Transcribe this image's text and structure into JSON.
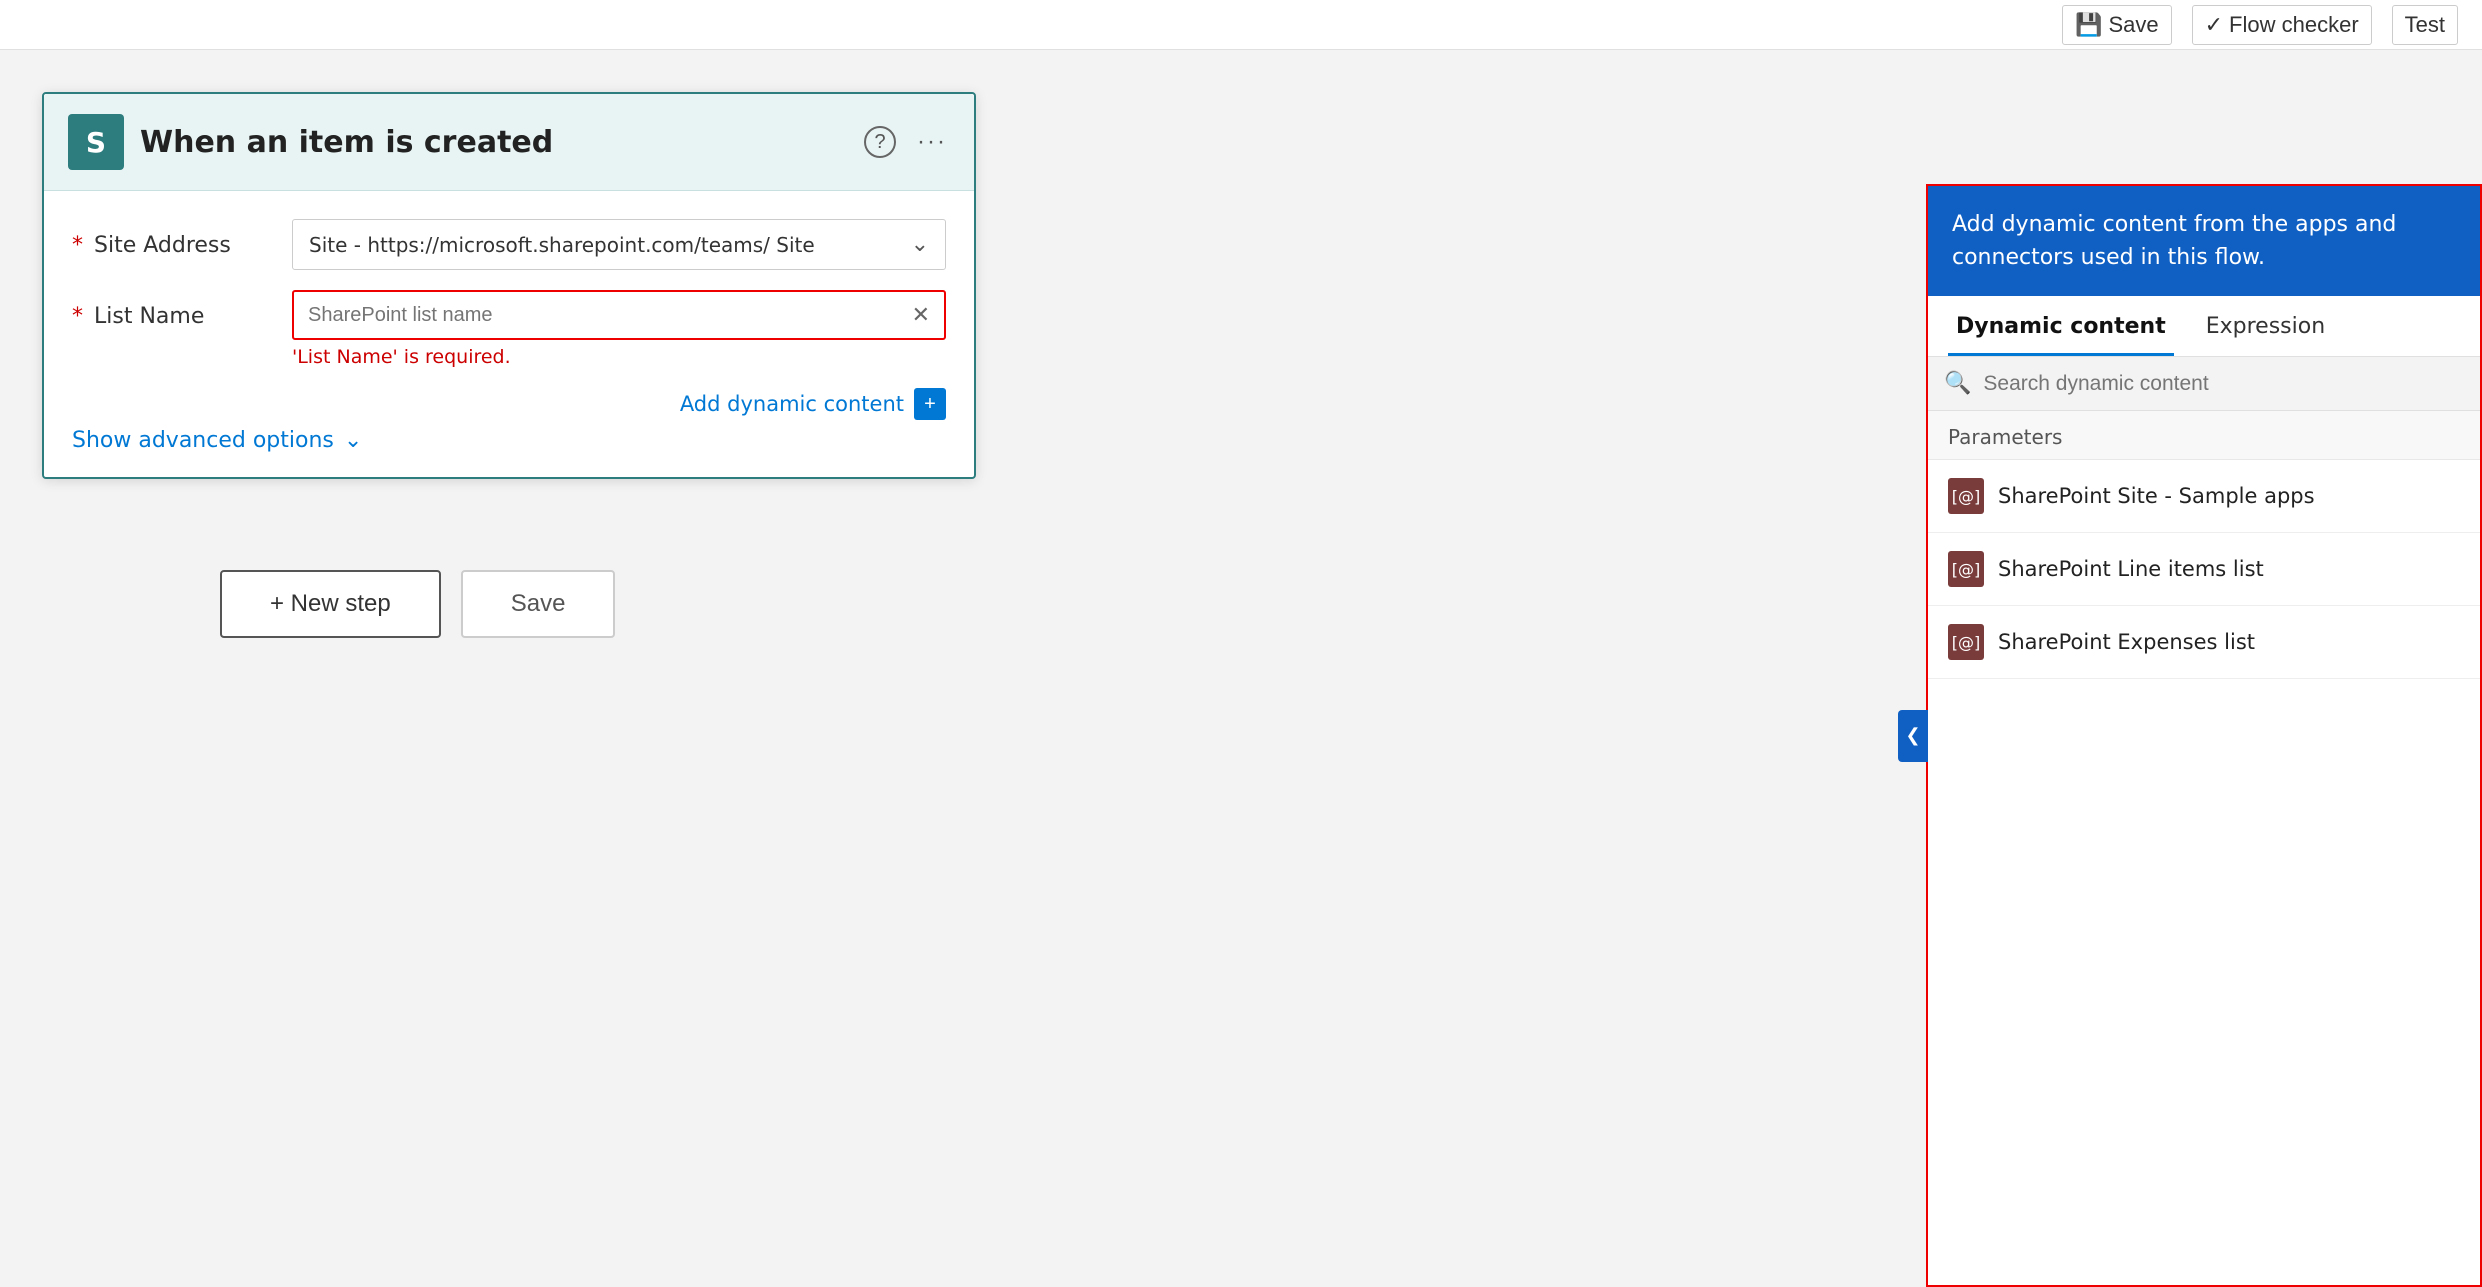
{
  "topbar": {
    "save_label": "Save",
    "flow_checker_label": "Flow checker",
    "test_label": "Test"
  },
  "card": {
    "icon_letter": "S",
    "title": "When an item is created",
    "site_address_label": "* Site Address",
    "site_address_value": "Site - https://microsoft.sharepoint.com/teams/    Site",
    "list_name_label": "* List Name",
    "list_name_placeholder": "SharePoint list name",
    "list_name_error": "'List Name' is required.",
    "dynamic_content_link": "Add dynamic content",
    "show_advanced_label": "Show advanced options"
  },
  "buttons": {
    "new_step": "+ New step",
    "save": "Save"
  },
  "dynamic_panel": {
    "header_text": "Add dynamic content from the apps and connectors used in this flow.",
    "tab_dynamic": "Dynamic content",
    "tab_expression": "Expression",
    "search_placeholder": "Search dynamic content",
    "section_label": "Parameters",
    "items": [
      {
        "label": "SharePoint Site - Sample apps",
        "icon": "[@]"
      },
      {
        "label": "SharePoint Line items list",
        "icon": "[@]"
      },
      {
        "label": "SharePoint Expenses list",
        "icon": "[@]"
      }
    ]
  }
}
